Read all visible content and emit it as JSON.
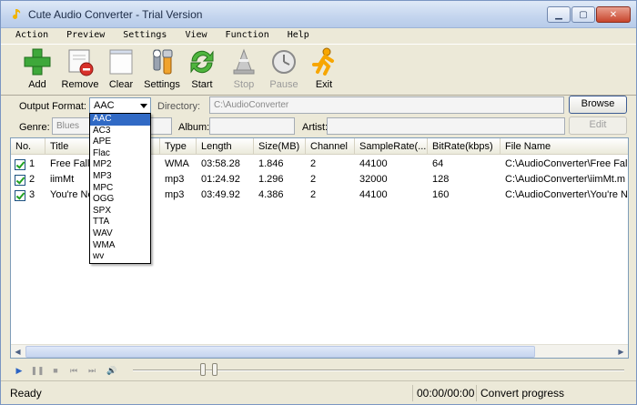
{
  "window": {
    "title": "Cute Audio Converter - Trial Version"
  },
  "menu": [
    "Action",
    "Preview",
    "Settings",
    "View",
    "Function",
    "Help"
  ],
  "toolbar": {
    "add": "Add",
    "remove": "Remove",
    "clear": "Clear",
    "settings": "Settings",
    "start": "Start",
    "stop": "Stop",
    "pause": "Pause",
    "exit": "Exit"
  },
  "output": {
    "format_label": "Output Format:",
    "format_value": "AAC",
    "directory_label": "Directory:",
    "directory_value": "C:\\AudioConverter",
    "browse": "Browse"
  },
  "tags": {
    "genre_label": "Genre:",
    "genre_value": "Blues",
    "album_label": "Album:",
    "album_value": "",
    "artist_label": "Artist:",
    "artist_value": "",
    "edit": "Edit"
  },
  "format_options": [
    "AAC",
    "AC3",
    "APE",
    "Flac",
    "MP2",
    "MP3",
    "MPC",
    "OGG",
    "SPX",
    "TTA",
    "WAV",
    "WMA",
    "wv"
  ],
  "columns": [
    "No.",
    "Title",
    "Type",
    "Length",
    "Size(MB)",
    "Channel",
    "SampleRate(...",
    "BitRate(kbps)",
    "File Name"
  ],
  "rows": [
    {
      "no": "1",
      "title": "Free Fall",
      "type": "WMA",
      "length": "03:58.28",
      "size": "1.846",
      "channel": "2",
      "samplerate": "44100",
      "bitrate": "64",
      "file": "C:\\AudioConverter\\Free Fall."
    },
    {
      "no": "2",
      "title": "iimMt",
      "type": "mp3",
      "length": "01:24.92",
      "size": "1.296",
      "channel": "2",
      "samplerate": "32000",
      "bitrate": "128",
      "file": "C:\\AudioConverter\\iimMt.m"
    },
    {
      "no": "3",
      "title": "You're No",
      "type": "mp3",
      "length": "03:49.92",
      "size": "4.386",
      "channel": "2",
      "samplerate": "44100",
      "bitrate": "160",
      "file": "C:\\AudioConverter\\You're N"
    }
  ],
  "status": {
    "ready": "Ready",
    "time": "00:00/00:00",
    "progress": "Convert progress"
  },
  "colors": {
    "selection": "#316ac5",
    "accent": "#2b63c4"
  }
}
